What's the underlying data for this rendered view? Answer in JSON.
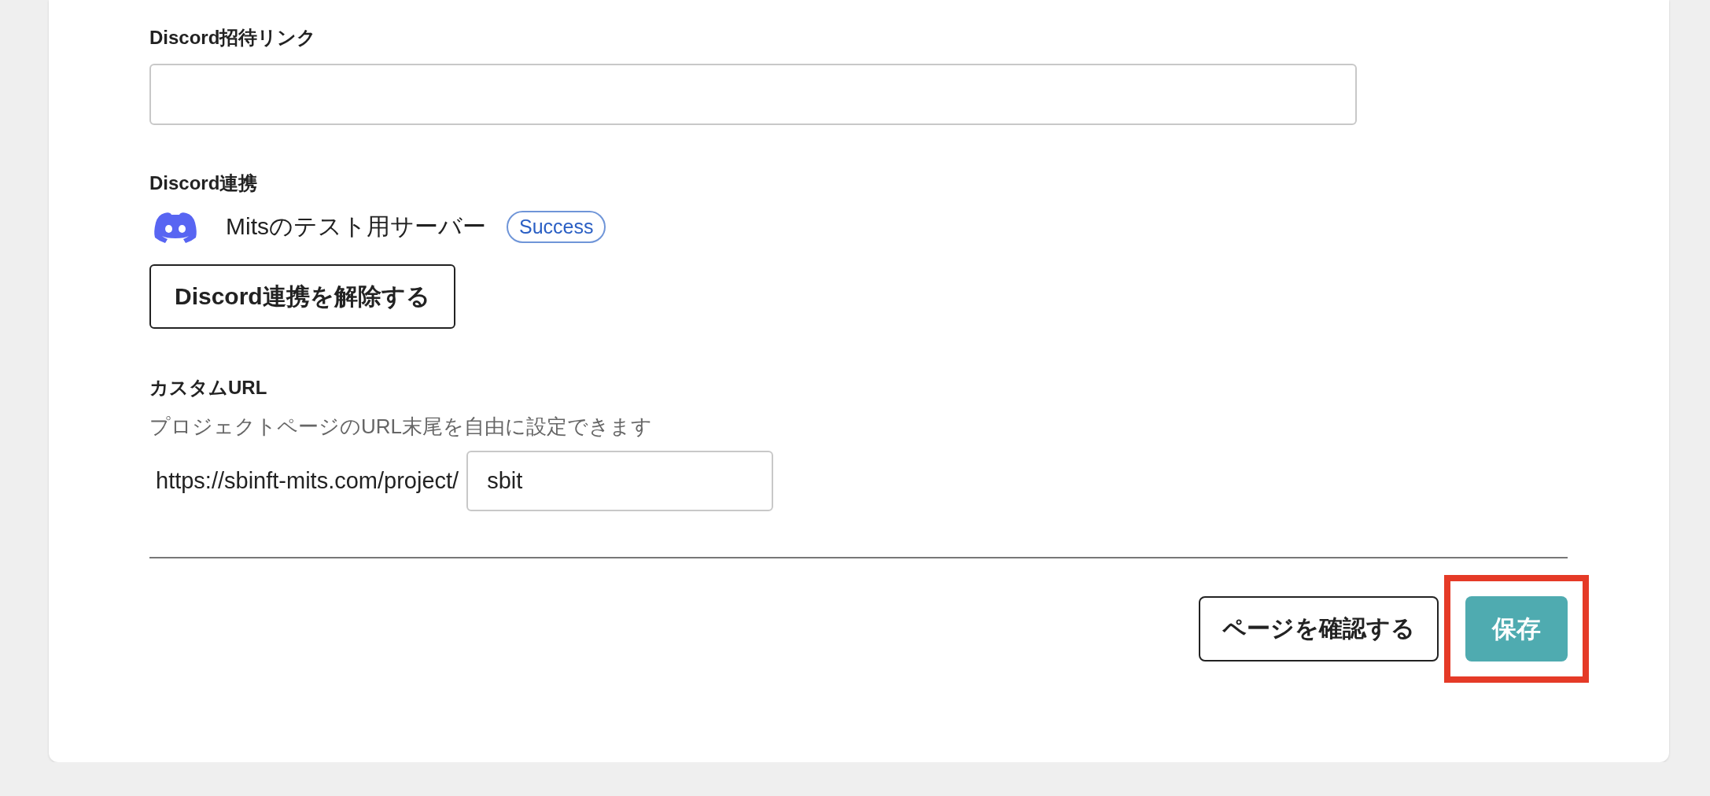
{
  "invite_link": {
    "label": "Discord招待リンク"
  },
  "discord_integration": {
    "label": "Discord連携",
    "server_name": "Mitsのテスト用サーバー",
    "status": "Success",
    "unlink_button": "Discord連携を解除する"
  },
  "custom_url": {
    "label": "カスタムURL",
    "description": "プロジェクトページのURL末尾を自由に設定できます",
    "prefix": "https://sbinft-mits.com/project/",
    "value": "sbit"
  },
  "buttons": [
    {
      "label": "ページを確認する",
      "kind": "outline",
      "highlighted": false
    },
    {
      "label": "保存",
      "kind": "primary",
      "highlighted": true
    }
  ]
}
